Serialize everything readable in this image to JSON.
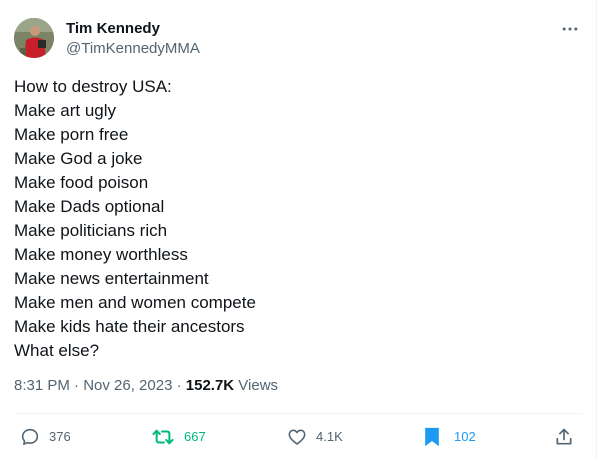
{
  "author": {
    "display_name": "Tim Kennedy",
    "handle": "@TimKennedyMMA"
  },
  "tweet": {
    "lines": [
      "How to destroy USA:",
      "Make art ugly",
      "Make porn free",
      "Make God a joke",
      "Make food poison",
      "Make Dads optional",
      "Make politicians rich",
      "Make money worthless",
      "Make news entertainment",
      "Make men and women compete",
      "Make kids hate their ancestors",
      "What else?"
    ],
    "timestamp": "8:31 PM · Nov 26, 2023 · ",
    "views_count": "152.7K",
    "views_label": " Views"
  },
  "actions": {
    "replies": "376",
    "retweets": "667",
    "likes": "4.1K",
    "bookmarks": "102"
  },
  "colors": {
    "text_primary": "#0f1419",
    "text_secondary": "#536471",
    "retweet_active": "#00ba7c",
    "bookmark_active": "#1d9bf0",
    "divider": "#eff3f4"
  },
  "icons": {
    "more": "more-dots-icon",
    "reply": "reply-bubble-icon",
    "retweet": "retweet-icon",
    "like": "heart-icon",
    "bookmark": "bookmark-icon",
    "share": "share-upload-icon"
  }
}
